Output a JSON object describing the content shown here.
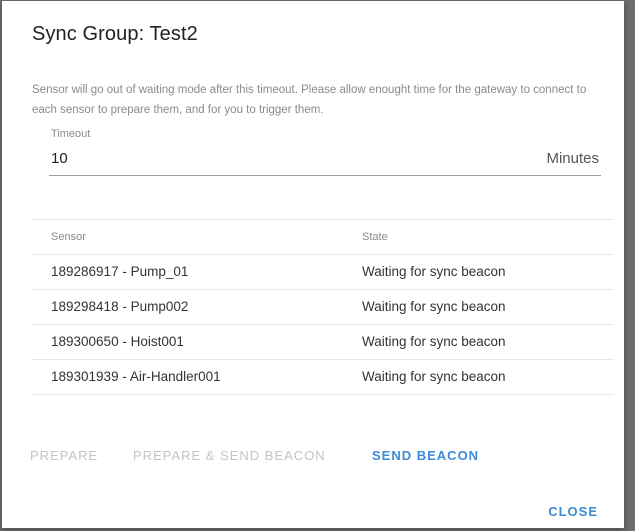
{
  "dialog": {
    "title": "Sync Group: Test2",
    "description": "Sensor will go out of waiting mode after this timeout. Please allow enought time for the gateway to connect to each sensor to prepare them, and for you to trigger them."
  },
  "timeout": {
    "label": "Timeout",
    "value": "10",
    "unit": "Minutes"
  },
  "table": {
    "headers": {
      "sensor": "Sensor",
      "state": "State"
    },
    "rows": [
      {
        "sensor": "189286917 - Pump_01",
        "state": "Waiting for sync beacon"
      },
      {
        "sensor": "189298418 - Pump002",
        "state": "Waiting for sync beacon"
      },
      {
        "sensor": "189300650 - Hoist001",
        "state": "Waiting for sync beacon"
      },
      {
        "sensor": "189301939 - Air-Handler001",
        "state": "Waiting for sync beacon"
      }
    ]
  },
  "actions": {
    "prepare_label": "PREPARE",
    "prepare_send_label": "PREPARE & SEND BEACON",
    "send_beacon_label": "SEND BEACON",
    "close_label": "CLOSE"
  },
  "colors": {
    "accent": "#3d8bd6",
    "disabled": "#c4c4c4"
  }
}
